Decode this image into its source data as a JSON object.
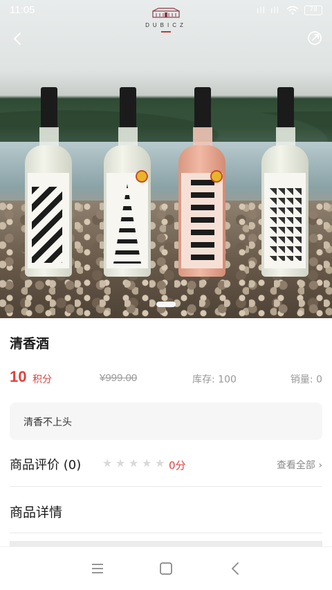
{
  "status_bar": {
    "time": "11:05",
    "signal1": "ıll",
    "signal2": "ıll",
    "battery": "78"
  },
  "brand": {
    "name": "DUBICZ"
  },
  "product": {
    "title": "清香酒",
    "points": "10",
    "points_unit": "积分",
    "original_price": "¥999.00",
    "stock_text": "库存: 100",
    "sales_text": "销量: 0",
    "description": "清香不上头"
  },
  "reviews": {
    "title": "商品评价 (0)",
    "stars_total": 5,
    "stars_filled": 0,
    "score_text": "0分",
    "view_all": "查看全部"
  },
  "details": {
    "title": "商品详情"
  },
  "icons": {
    "back": "chevron-left-icon",
    "share": "share-icon",
    "menu": "menu-icon",
    "home": "square-icon",
    "sys_back": "chevron-left-icon"
  },
  "colors": {
    "accent": "#e0413d",
    "muted": "#999999",
    "brand": "#6b2a33"
  }
}
